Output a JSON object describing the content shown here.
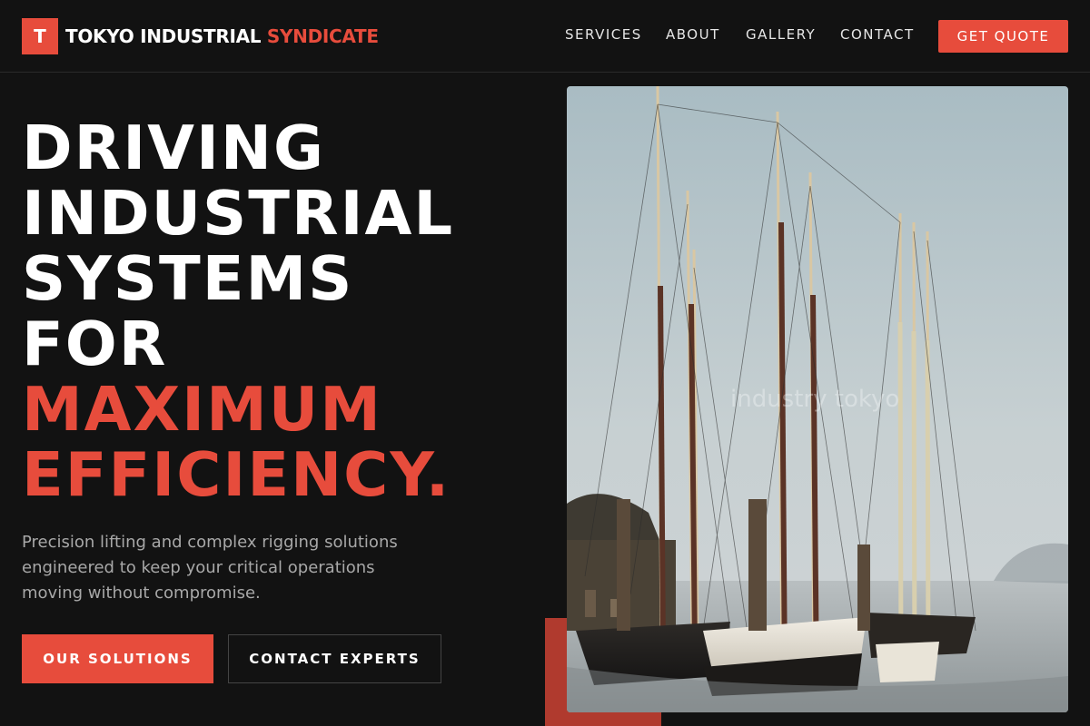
{
  "brand": {
    "logo_letter": "T",
    "name_main": "TOKYO INDUSTRIAL",
    "name_accent": "SYNDICATE"
  },
  "nav": {
    "items": [
      {
        "label": "SERVICES"
      },
      {
        "label": "ABOUT"
      },
      {
        "label": "GALLERY"
      },
      {
        "label": "CONTACT"
      }
    ],
    "cta_label": "GET QUOTE"
  },
  "hero": {
    "title_lines": [
      "DRIVING",
      "INDUSTRIAL",
      "SYSTEMS",
      "FOR"
    ],
    "title_accent_lines": [
      "MAXIMUM",
      "EFFICIENCY."
    ],
    "subtitle": "Precision lifting and complex rigging solutions engineered to keep your critical operations moving without compromise.",
    "primary_button": "OUR SOLUTIONS",
    "secondary_button": "CONTACT EXPERTS"
  },
  "image": {
    "watermark": "industry tokyo",
    "subject": "tall-ships-harbor-photo"
  },
  "colors": {
    "accent": "#e74c3c",
    "background": "#121212",
    "text": "#ffffff",
    "muted_text": "#a8a8a8"
  }
}
